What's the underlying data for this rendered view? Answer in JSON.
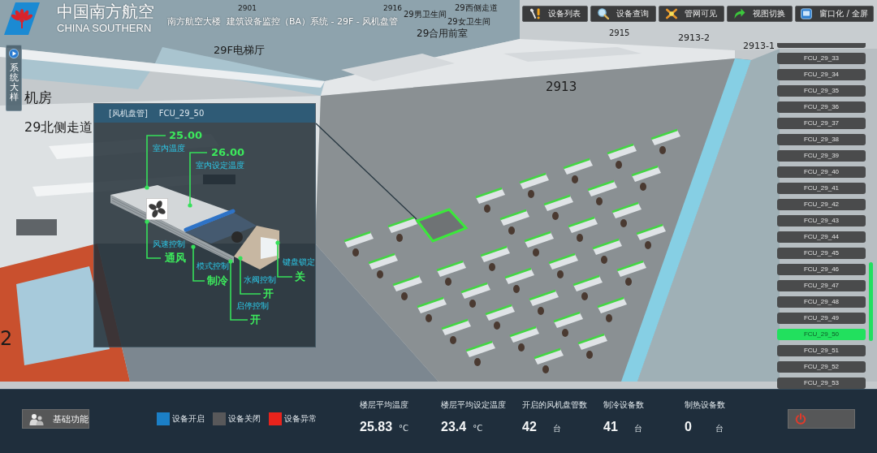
{
  "header": {
    "logo_cn": "中国南方航空",
    "logo_en": "CHINA SOUTHERN",
    "title": "南方航空大楼  建筑设备监控（BA）系统 - 29F - 风机盘管"
  },
  "toolbar": [
    {
      "label": "设备列表"
    },
    {
      "label": "设备查询"
    },
    {
      "label": "管网可见"
    },
    {
      "label": "视图切换"
    },
    {
      "label": "窗口化 / 全屏"
    }
  ],
  "side_tab": {
    "label": "系统大样"
  },
  "scene_labels": [
    "2901",
    "2916",
    "29男卫生间",
    "29西侧走道",
    "29女卫生间",
    "29合用前室",
    "29F电梯厅",
    "2915",
    "2913-2",
    "2913-1",
    "2913",
    "机房",
    "29北侧走道",
    "2"
  ],
  "info_panel": {
    "category": "[风机盘管]",
    "device": "FCU_29_50",
    "readings": [
      {
        "kind": "measure",
        "label": "室内温度",
        "value": "25.00"
      },
      {
        "kind": "measure",
        "label": "室内设定温度",
        "value": "26.00"
      },
      {
        "kind": "control",
        "label": "风速控制",
        "value": "通风"
      },
      {
        "kind": "control",
        "label": "键盘锁定",
        "value": "关"
      },
      {
        "kind": "control",
        "label": "模式控制",
        "value": "制冷"
      },
      {
        "kind": "control",
        "label": "水阀控制",
        "value": "开"
      },
      {
        "kind": "control",
        "label": "启停控制",
        "value": "开"
      }
    ]
  },
  "device_list": [
    {
      "label": "FCU_29_33",
      "selected": false
    },
    {
      "label": "FCU_29_34",
      "selected": false
    },
    {
      "label": "FCU_29_35",
      "selected": false
    },
    {
      "label": "FCU_29_36",
      "selected": false
    },
    {
      "label": "FCU_29_37",
      "selected": false
    },
    {
      "label": "FCU_29_38",
      "selected": false
    },
    {
      "label": "FCU_29_39",
      "selected": false
    },
    {
      "label": "FCU_29_40",
      "selected": false
    },
    {
      "label": "FCU_29_41",
      "selected": false
    },
    {
      "label": "FCU_29_42",
      "selected": false
    },
    {
      "label": "FCU_29_43",
      "selected": false
    },
    {
      "label": "FCU_29_44",
      "selected": false
    },
    {
      "label": "FCU_29_45",
      "selected": false
    },
    {
      "label": "FCU_29_46",
      "selected": false
    },
    {
      "label": "FCU_29_47",
      "selected": false
    },
    {
      "label": "FCU_29_48",
      "selected": false
    },
    {
      "label": "FCU_29_49",
      "selected": false
    },
    {
      "label": "FCU_29_50",
      "selected": true
    },
    {
      "label": "FCU_29_51",
      "selected": false
    },
    {
      "label": "FCU_29_52",
      "selected": false
    },
    {
      "label": "FCU_29_53",
      "selected": false
    }
  ],
  "bottom_bar": {
    "function_button": "基础功能",
    "legend": [
      {
        "label": "设备开启",
        "color": "#1b7fc6"
      },
      {
        "label": "设备关闭",
        "color": "#58585a"
      },
      {
        "label": "设备异常",
        "color": "#e8231c"
      }
    ],
    "stats": [
      {
        "label": "楼层平均温度",
        "value": "25.83",
        "unit": "°C"
      },
      {
        "label": "楼层平均设定温度",
        "value": "23.4",
        "unit": "°C"
      },
      {
        "label": "开启的风机盘管数",
        "value": "42",
        "unit": "台"
      },
      {
        "label": "制冷设备数",
        "value": "41",
        "unit": "台"
      },
      {
        "label": "制热设备数",
        "value": "0",
        "unit": "台"
      }
    ]
  }
}
